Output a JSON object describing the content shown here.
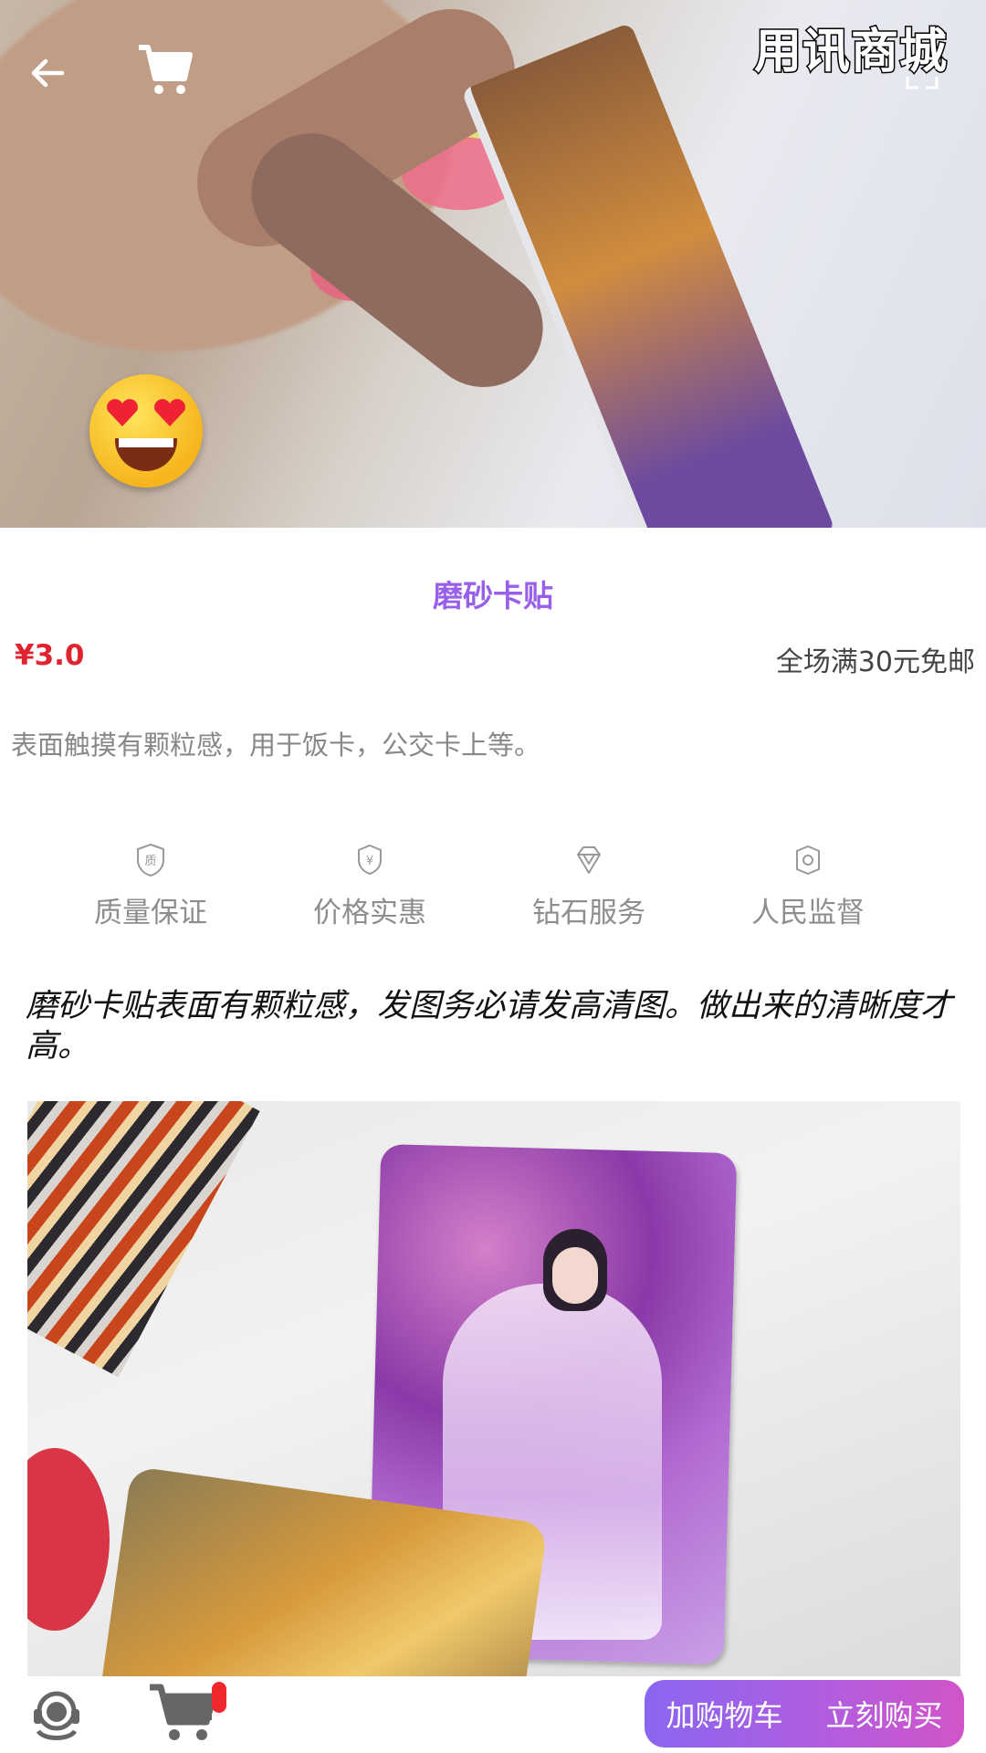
{
  "hero": {
    "watermark": "用讯商城",
    "icons": {
      "back": "arrow-left-icon",
      "cart": "shopping-cart-icon",
      "fullscreen": "expand-icon",
      "emoji": "heart-eyes-emoji"
    }
  },
  "product": {
    "title": "磨砂卡贴",
    "price": "¥3.0",
    "shipping": "全场满30元免邮",
    "description": "表面触摸有颗粒感，用于饭卡，公交卡上等。"
  },
  "features": [
    {
      "label": "质量保证",
      "icon": "quality-shield-icon"
    },
    {
      "label": "价格实惠",
      "icon": "yuan-shield-icon"
    },
    {
      "label": "钻石服务",
      "icon": "diamond-icon"
    },
    {
      "label": "人民监督",
      "icon": "supervision-icon"
    }
  ],
  "detail": {
    "text": "磨砂卡贴表面有颗粒感，发图务必请发高清图。做出来的清晰度才高。"
  },
  "bottom_bar": {
    "service_icon": "customer-service-icon",
    "cart_icon": "shopping-cart-icon",
    "add_to_cart": "加购物车",
    "buy_now": "立刻购买"
  },
  "colors": {
    "title": "#9860e8",
    "price": "#e0232e",
    "button_gradient_start": "#8a66f0",
    "button_gradient_end": "#d155c8",
    "badge": "#f0282d"
  }
}
